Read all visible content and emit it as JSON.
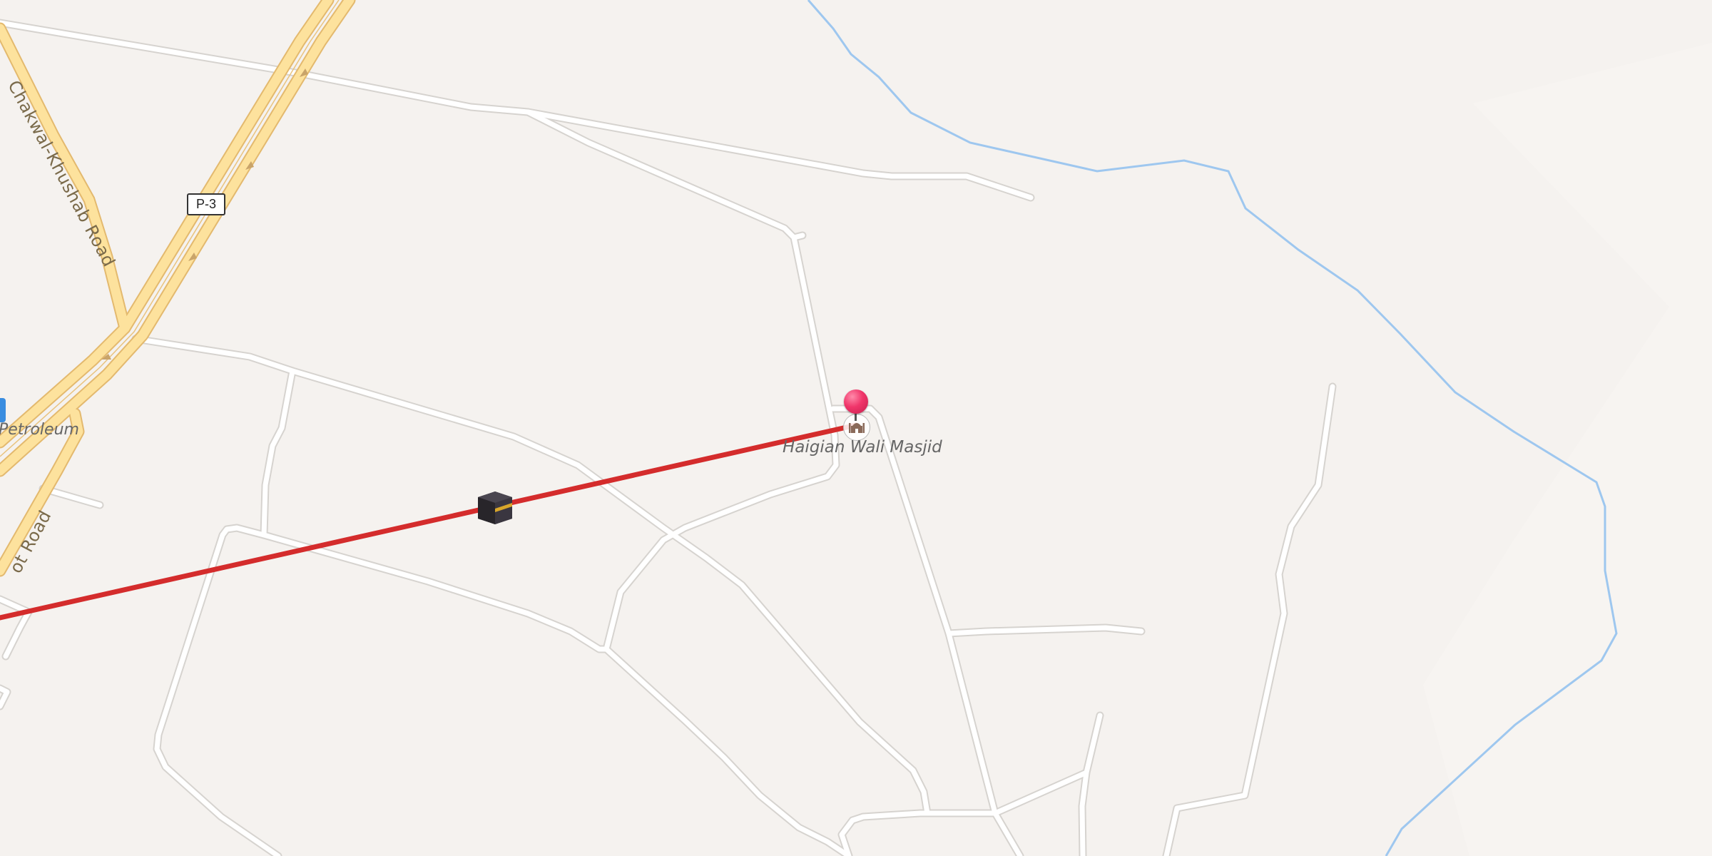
{
  "map": {
    "poi_label": "Haigian Wali Masjid",
    "road_labels": {
      "chakwal_khushab": "Chakwal-Khushab Road",
      "partial_road": "ot Road",
      "petroleum": "Petroleum"
    },
    "route_shield": "P-3",
    "icons": {
      "destination": "red-pin-icon",
      "mosque": "mosque-icon",
      "qibla": "kaaba-icon",
      "fuel": "fuel-station-icon"
    },
    "colors": {
      "background": "#f5f2ef",
      "major_road": "#fde29d",
      "major_road_casing": "#e3b96e",
      "minor_road": "#ffffff",
      "minor_road_casing": "#d6d3cf",
      "water": "#9ec7ef",
      "qibla_line": "#d42c2c",
      "pin": "#f0356a"
    }
  }
}
